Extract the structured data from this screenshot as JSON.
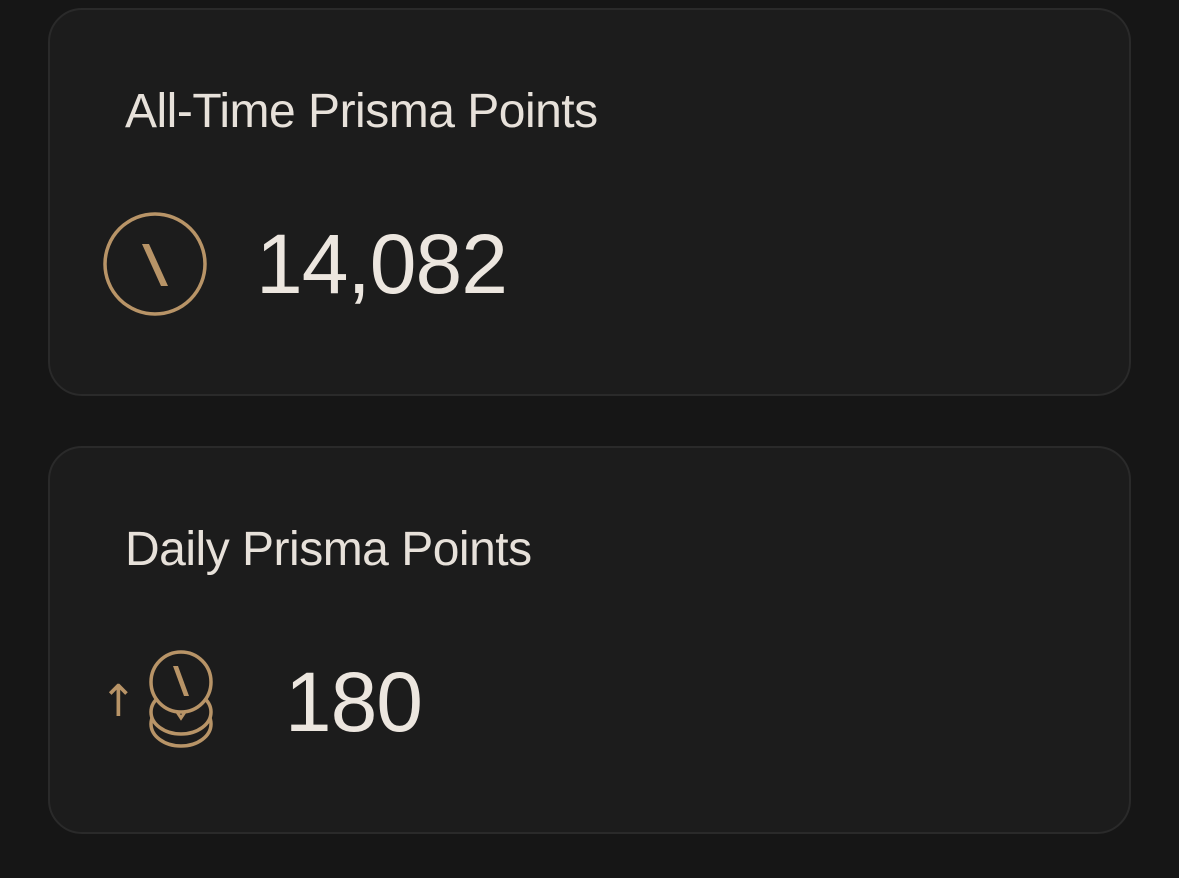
{
  "cards": {
    "all_time": {
      "title": "All-Time Prisma Points",
      "value": "14,082",
      "icon": "prisma-coin-icon"
    },
    "daily": {
      "title": "Daily Prisma Points",
      "value": "180",
      "icon": "coin-stack-icon",
      "trend_icon": "arrow-up-icon",
      "trend_glyph": "↑"
    }
  },
  "colors": {
    "background": "#161616",
    "card": "#1c1c1c",
    "card_border": "#2a2a2a",
    "text": "#ece6df",
    "accent_gold": "#b89467"
  }
}
